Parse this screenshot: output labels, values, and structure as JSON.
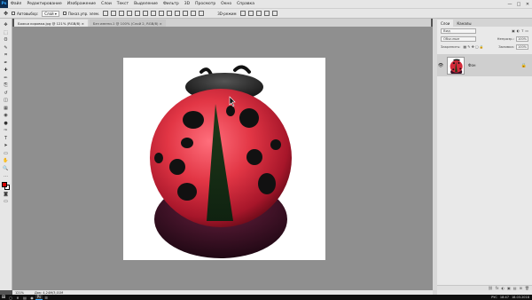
{
  "app": {
    "logo": "Ps"
  },
  "menu": [
    "Файл",
    "Редактирование",
    "Изображение",
    "Слои",
    "Текст",
    "Выделение",
    "Фильтр",
    "3D",
    "Просмотр",
    "Окно",
    "Справка"
  ],
  "window_controls": [
    "—",
    "□",
    "✕"
  ],
  "options_bar": {
    "autoselect_label": "Автовыбор:",
    "layer_select": "Слой",
    "transform_label": "Показ.упр. элем.",
    "mode_3d": "3D-режим"
  },
  "document_tabs": [
    {
      "label": "Божья коровка.jpg @ 121% (RGB/8) ×",
      "active": true
    },
    {
      "label": "Без имени-1 @ 100% (Слой 2, RGB/8) ×",
      "active": false
    }
  ],
  "tools": [
    "move-icon",
    "marquee-icon",
    "lasso-icon",
    "quick-select-icon",
    "crop-icon",
    "eyedropper-icon",
    "healing-icon",
    "brush-icon",
    "stamp-icon",
    "history-brush-icon",
    "eraser-icon",
    "gradient-icon",
    "blur-icon",
    "dodge-icon",
    "pen-icon",
    "type-icon",
    "path-select-icon",
    "shape-icon",
    "hand-icon",
    "zoom-icon",
    "more-icon"
  ],
  "tool_glyphs": [
    "✥",
    "⬚",
    "ʘ",
    "✎",
    "⌗",
    "✒",
    "✚",
    "✏",
    "⎘",
    "↺",
    "◫",
    "▦",
    "◉",
    "●",
    "✑",
    "T",
    "➤",
    "▭",
    "✋",
    "🔍",
    "…"
  ],
  "colors": {
    "foreground": "#d40000",
    "background": "#ffffff",
    "canvas_bg": "#8f8f8f"
  },
  "statusbar": {
    "zoom": "121%",
    "doc_info": "Док: 4,24М/3,01М"
  },
  "panel": {
    "tabs": [
      "Слои",
      "Каналы"
    ],
    "kind_filter": "Вид",
    "blend_mode": "Обычные",
    "opacity_label": "Непрозр.:",
    "opacity_value": "100%",
    "lock_label": "Закрепить:",
    "fill_label": "Заливка:",
    "fill_value": "100%",
    "layer_name": "Фон",
    "footer_icons": [
      "fx",
      "◐",
      "▣",
      "▤",
      "⊞",
      "🗑"
    ]
  },
  "taskbar": {
    "start": "⊞",
    "items": [
      "◻",
      "e",
      "▤",
      "◉",
      "Ps",
      "☰"
    ],
    "time": "18:47",
    "date": "18.03.2018",
    "lang": "РУС"
  }
}
